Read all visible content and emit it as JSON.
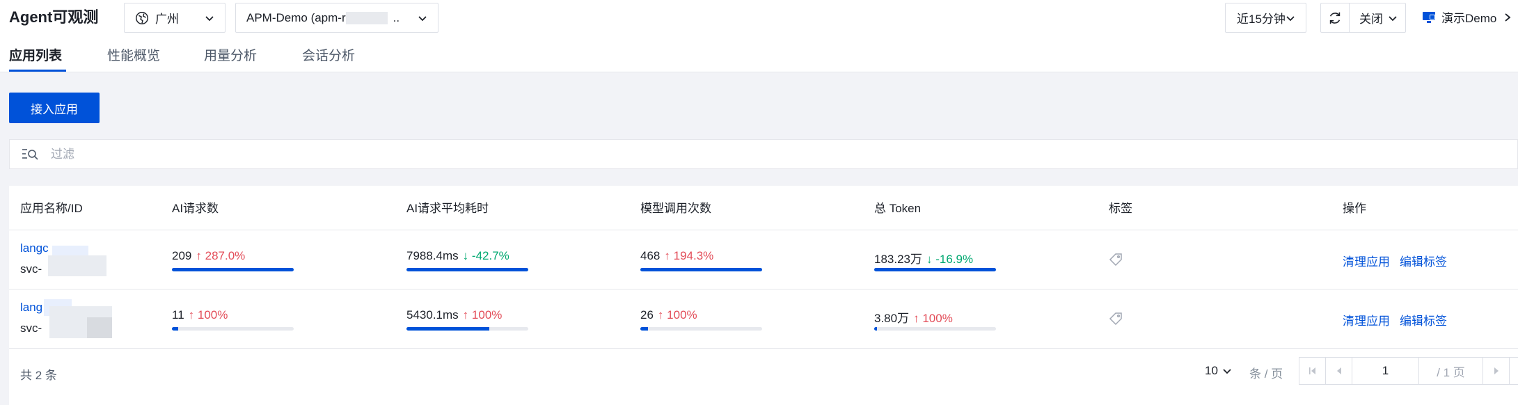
{
  "header": {
    "app_title": "Agent可观测",
    "region": "广州",
    "instance": "APM-Demo (apm-r",
    "instance_suffix": "..",
    "time_range": "近15分钟",
    "auto_refresh": "关闭",
    "demo_link": "演示Demo"
  },
  "tabs": [
    {
      "label": "应用列表",
      "active": true
    },
    {
      "label": "性能概览",
      "active": false
    },
    {
      "label": "用量分析",
      "active": false
    },
    {
      "label": "会话分析",
      "active": false
    }
  ],
  "toolbar": {
    "connect_button": "接入应用",
    "filter_placeholder": "过滤"
  },
  "table": {
    "columns": [
      "应用名称/ID",
      "AI请求数",
      "AI请求平均耗时",
      "模型调用次数",
      "总 Token",
      "标签",
      "操作"
    ],
    "rows": [
      {
        "name": "langc",
        "id": "svc-",
        "ai_requests": {
          "value": "209",
          "change": "287.0%",
          "direction": "up",
          "progress": 1.0
        },
        "avg_latency": {
          "value": "7988.4ms",
          "change": "-42.7%",
          "direction": "down",
          "progress": 1.0
        },
        "model_calls": {
          "value": "468",
          "change": "194.3%",
          "direction": "up",
          "progress": 1.0
        },
        "total_token": {
          "value": "183.23万",
          "change": "-16.9%",
          "direction": "down",
          "progress": 1.0
        },
        "actions": [
          "清理应用",
          "编辑标签"
        ]
      },
      {
        "name": "lang",
        "id": "svc-",
        "ai_requests": {
          "value": "11",
          "change": "100%",
          "direction": "up",
          "progress": 0.05
        },
        "avg_latency": {
          "value": "5430.1ms",
          "change": "100%",
          "direction": "up",
          "progress": 0.68
        },
        "model_calls": {
          "value": "26",
          "change": "100%",
          "direction": "up",
          "progress": 0.06
        },
        "total_token": {
          "value": "3.80万",
          "change": "100%",
          "direction": "up",
          "progress": 0.02
        },
        "actions": [
          "清理应用",
          "编辑标签"
        ]
      }
    ]
  },
  "pagination": {
    "total_text": "共 2 条",
    "page_size": "10",
    "per_page_label": "条 / 页",
    "current_page": "1",
    "total_pages_text": "/ 1 页"
  },
  "colors": {
    "primary": "#0052d9",
    "up": "#e34d59",
    "down": "#00a870"
  }
}
